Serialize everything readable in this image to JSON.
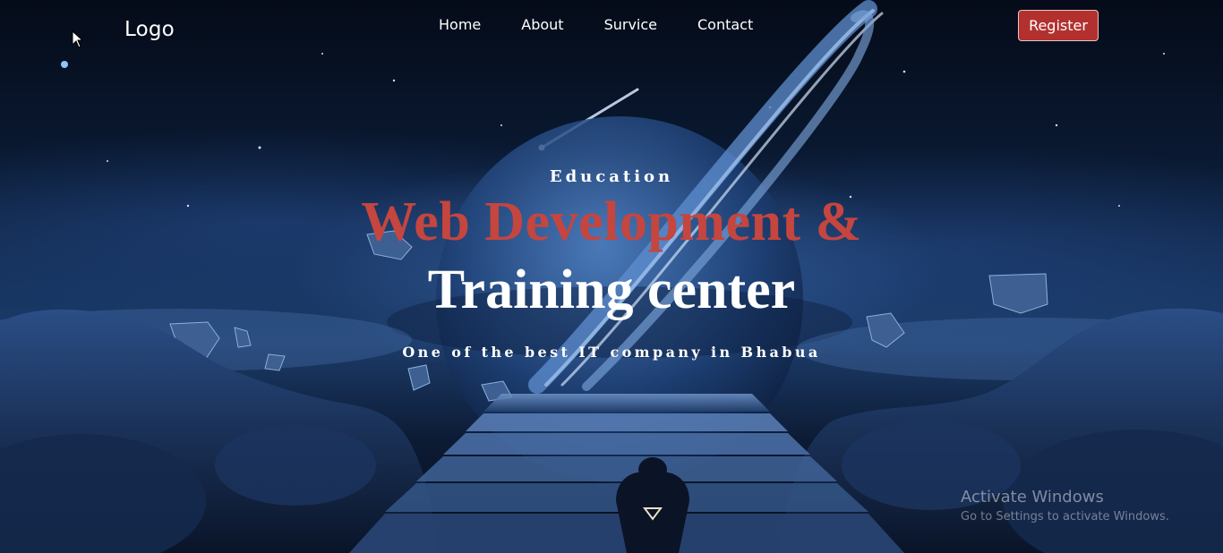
{
  "nav": {
    "logo": "Logo",
    "links": [
      "Home",
      "About",
      "Survice",
      "Contact"
    ],
    "register": "Register"
  },
  "hero": {
    "eyebrow": "Education",
    "line1": "Web Development &",
    "line2": "Training center",
    "tagline": "One of the best IT company in Bhabua"
  },
  "watermark": {
    "title": "Activate Windows",
    "subtitle": "Go to Settings to activate Windows."
  },
  "colors": {
    "accent_red": "#c5453f",
    "register_bg": "#b2312f",
    "text": "#ffffff"
  },
  "icons": {
    "cursor": "mouse-pointer-icon"
  }
}
